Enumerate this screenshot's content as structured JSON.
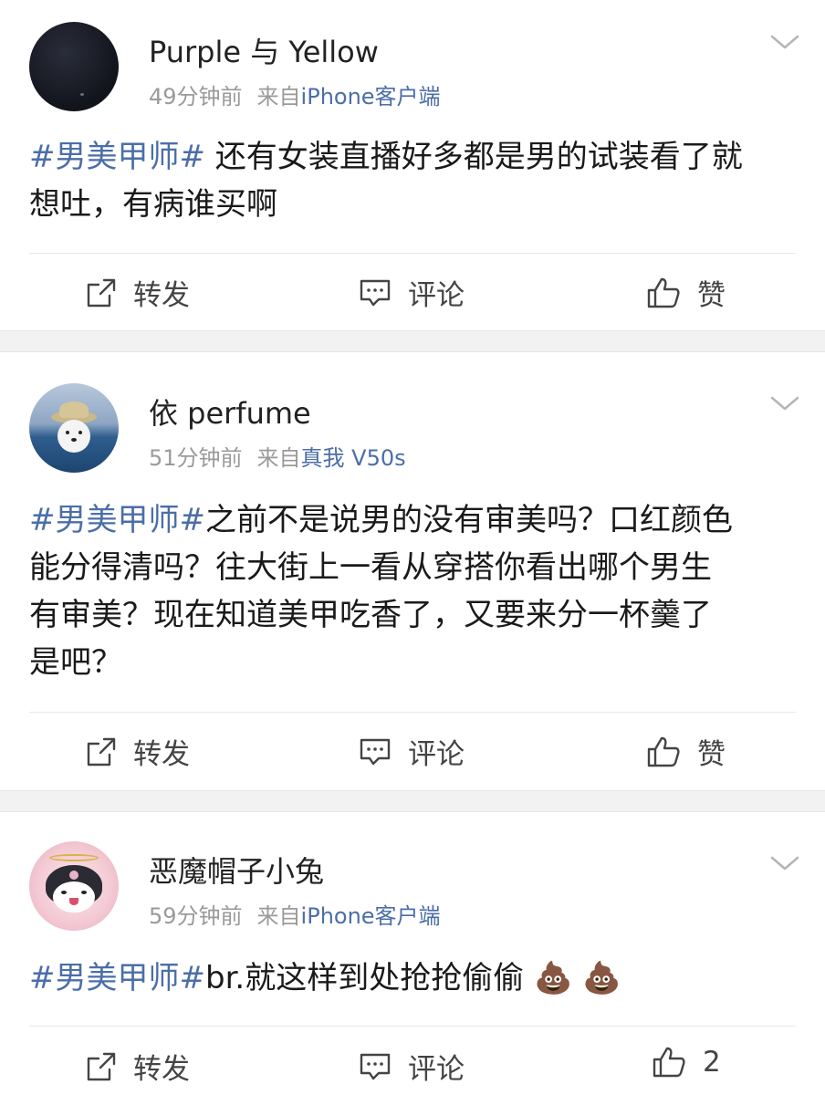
{
  "posts": [
    {
      "username": "Purple 与 Yellow",
      "time": "49分钟前",
      "from_prefix": "来自",
      "source": "iPhone客户端",
      "hashtag": "#男美甲师#",
      "text_line1": " 还有女装直播好多都是男的试装看了就",
      "text_line2": "想吐，有病谁买啊",
      "repost_label": "转发",
      "comment_label": "评论",
      "like_label": "赞"
    },
    {
      "username": "依 perfume",
      "time": "51分钟前",
      "from_prefix": "来自",
      "source": "真我 V50s",
      "hashtag": "#男美甲师#",
      "text_line1": "之前不是说男的没有审美吗？口红颜色",
      "text_line2": "能分得清吗？往大街上一看从穿搭你看出哪个男生",
      "text_line3": "有审美？现在知道美甲吃香了，又要来分一杯羹了",
      "text_line4": "是吧？",
      "repost_label": "转发",
      "comment_label": "评论",
      "like_label": "赞"
    },
    {
      "username": "恶魔帽子小兔",
      "time": "59分钟前",
      "from_prefix": "来自",
      "source": "iPhone客户端",
      "hashtag": "#男美甲师#",
      "text_line1": "br.就这样到处抢抢偷偷",
      "emoji": "💩 💩",
      "repost_label": "转发",
      "comment_label": "评论",
      "like_count": "2"
    }
  ],
  "colors": {
    "link": "#4b6ea8",
    "meta": "#9a9a9a",
    "separator": "#f2f2f2"
  },
  "icons": [
    "chevron-down-icon",
    "repost-icon",
    "comment-icon",
    "like-icon"
  ]
}
